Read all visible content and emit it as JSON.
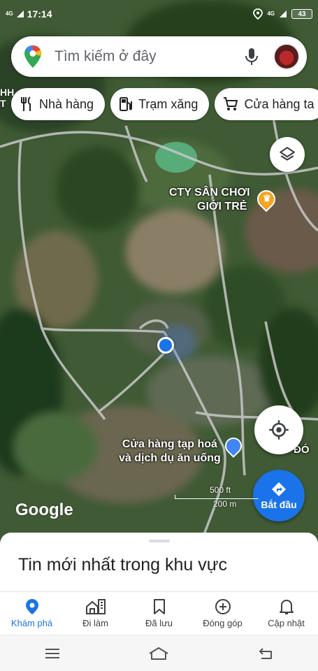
{
  "status_bar": {
    "time": "17:14",
    "network_left": "4G",
    "network_right": "4G",
    "battery": "43"
  },
  "search": {
    "placeholder": "Tìm kiếm ở đây",
    "icons": [
      "maps-pin-icon",
      "mic-icon",
      "avatar"
    ]
  },
  "chips": [
    {
      "label": "Nhà hàng",
      "icon": "restaurant-icon"
    },
    {
      "label": "Trạm xăng",
      "icon": "gas-station-icon"
    },
    {
      "label": "Cửa hàng ta",
      "icon": "shopping-cart-icon"
    }
  ],
  "map": {
    "left_edge_label": "HH\nT",
    "places": [
      {
        "name_line1": "CTY SÂN CHƠI",
        "name_line2": "GIỚI TRẺ",
        "icon": "trophy-pin-icon"
      },
      {
        "name_line1": "Cửa hàng tạp hoá",
        "name_line2": "và dịch dụ ăn uống",
        "icon": "shopping-pin-icon"
      }
    ],
    "right_edge_label": "ĐÓ",
    "scale_ft": "500 ft",
    "scale_m": "200 m",
    "logo": "Google"
  },
  "start_button": {
    "label": "Bắt đầu"
  },
  "sheet": {
    "title": "Tin mới nhất trong khu vực"
  },
  "tabs": [
    {
      "label": "Khám phá",
      "icon": "explore-pin-icon",
      "active": true
    },
    {
      "label": "Đi làm",
      "icon": "commute-icon",
      "active": false
    },
    {
      "label": "Đã lưu",
      "icon": "bookmark-icon",
      "active": false
    },
    {
      "label": "Đóng góp",
      "icon": "add-circle-icon",
      "active": false
    },
    {
      "label": "Cập nhật",
      "icon": "bell-icon",
      "active": false
    }
  ],
  "colors": {
    "accent": "#1a73e8",
    "map_dark": "#2d4a2a"
  }
}
